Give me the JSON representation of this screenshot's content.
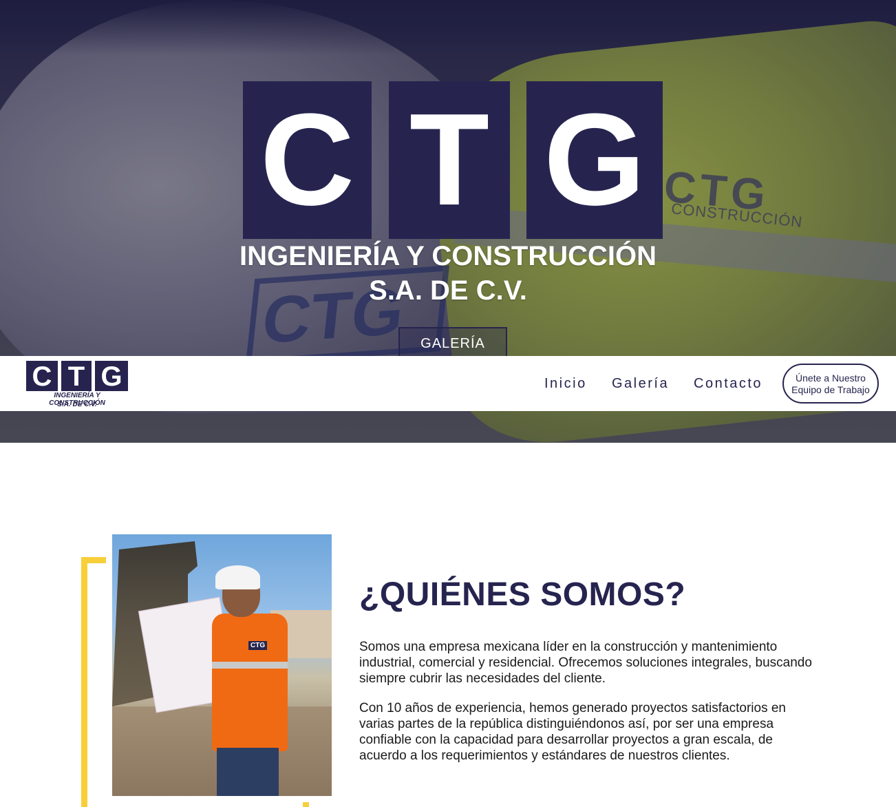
{
  "hero": {
    "logo_letters": [
      "C",
      "T",
      "G"
    ],
    "title_line1": "INGENIERÍA Y CONSTRUCCIÓN",
    "title_line2": "S.A. DE C.V.",
    "button_label": "GALERÍA"
  },
  "navbar": {
    "logo_letters": [
      "C",
      "T",
      "G"
    ],
    "logo_line1": "INGENIERÍA Y CONSTRUCCIÓN",
    "logo_line2": "S.A. DE C.V.",
    "links": [
      {
        "label": "Inicio"
      },
      {
        "label": "Galería"
      },
      {
        "label": "Contacto"
      }
    ],
    "join_line1": "Únete a Nuestro",
    "join_line2": "Equipo de Trabajo"
  },
  "about": {
    "title": "¿QUIÉNES SOMOS?",
    "paragraphs": [
      "Somos una empresa mexicana líder en la construcción y mantenimiento industrial, comercial y residencial. Ofrecemos soluciones integrales, buscando siempre cubrir las necesidades del cliente.",
      "Con 10 años de experiencia, hemos generado proyectos satisfactorios en varias partes de la república distinguiéndonos así, por ser una empresa confiable con la capacidad para desarrollar proyectos a gran escala, de acuerdo a los requerimientos y estándares de nuestros clientes."
    ]
  },
  "colors": {
    "brand_navy": "#26244f",
    "accent_yellow": "#f7cf3a",
    "white": "#ffffff"
  }
}
